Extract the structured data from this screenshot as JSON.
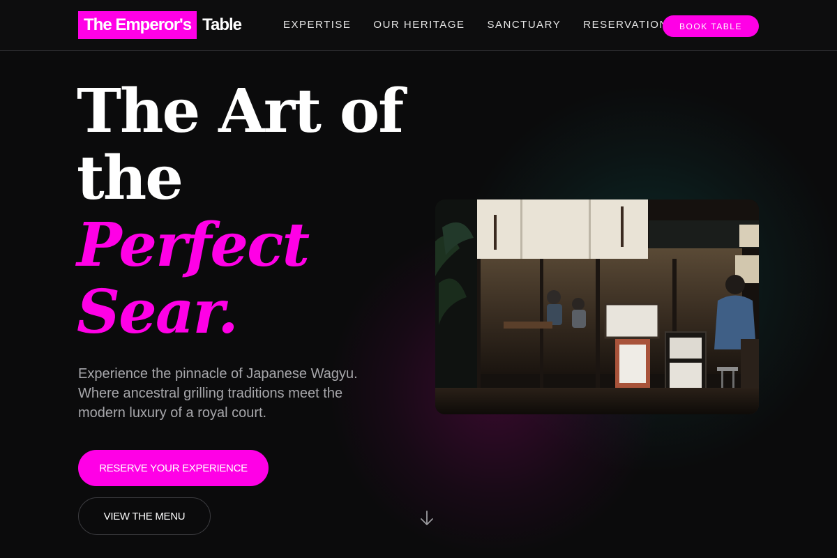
{
  "header": {
    "logo_highlight": "The Emperor's",
    "logo_rest": "Table",
    "nav": [
      "EXPERTISE",
      "OUR HERITAGE",
      "SANCTUARY",
      "RESERVATIONS"
    ],
    "cta": "BOOK TABLE"
  },
  "hero": {
    "headline_line1": "The Art of",
    "headline_line2": "the",
    "headline_accent1": "Perfect",
    "headline_accent2": "Sear.",
    "subtitle": "Experience the pinnacle of Japanese Wagyu. Where ancestral grilling traditions meet the modern luxury of a royal court.",
    "primary_button": "RESERVE YOUR EXPERIENCE",
    "secondary_button": "VIEW THE MENU",
    "scroll_icon": "arrow-down-icon",
    "image": "restaurant-storefront-night"
  },
  "colors": {
    "accent": "#ff00e6",
    "background": "#0b0b0c",
    "muted_text": "#a7a7ab"
  }
}
